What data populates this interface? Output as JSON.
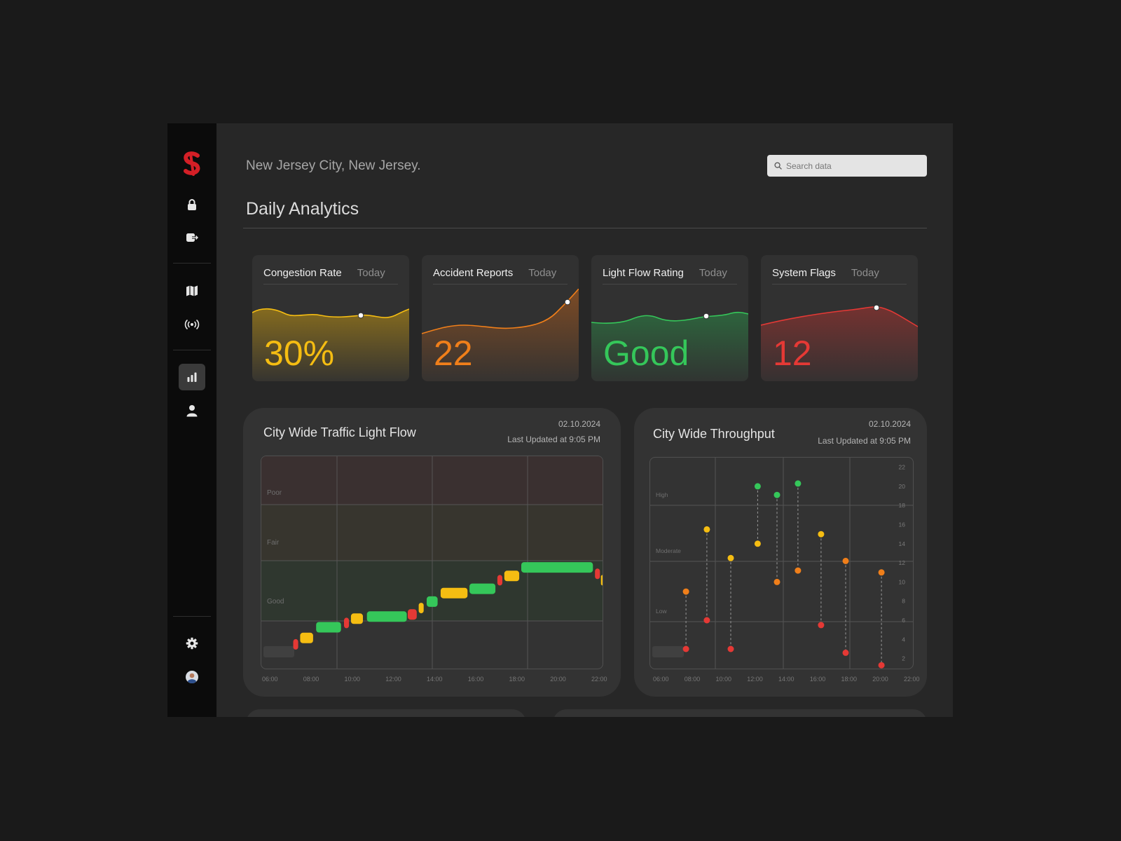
{
  "header": {
    "location": "New Jersey City, New Jersey.",
    "search_placeholder": "Search data",
    "page_title": "Daily Analytics"
  },
  "colors": {
    "yellow": "#f5bd12",
    "orange": "#f07f1a",
    "green": "#35c75a",
    "red": "#e53935",
    "brand": "#d41f26"
  },
  "sidebar": {
    "items": [
      {
        "icon": "lock-icon"
      },
      {
        "icon": "logout-icon"
      },
      {
        "icon": "map-icon"
      },
      {
        "icon": "broadcast-icon"
      },
      {
        "icon": "bar-chart-icon",
        "active": true
      },
      {
        "icon": "user-icon"
      },
      {
        "icon": "gear-icon"
      },
      {
        "icon": "avatar"
      }
    ]
  },
  "kpis": [
    {
      "name": "Congestion Rate",
      "period": "Today",
      "value": "30%",
      "color": "#f5bd12"
    },
    {
      "name": "Accident Reports",
      "period": "Today",
      "value": "22",
      "color": "#f07f1a"
    },
    {
      "name": "Light Flow Rating",
      "period": "Today",
      "value": "Good",
      "color": "#35c75a"
    },
    {
      "name": "System Flags",
      "period": "Today",
      "value": "12",
      "color": "#e53935"
    }
  ],
  "cards": {
    "light_flow": {
      "title": "City Wide Traffic Light Flow",
      "date": "02.10.2024",
      "updated": "Last Updated at 9:05 PM"
    },
    "throughput": {
      "title": "City Wide Throughput",
      "date": "02.10.2024",
      "updated": "Last Updated at 9:05 PM"
    }
  },
  "chart_data": [
    {
      "type": "bar",
      "title": "City Wide Traffic Light Flow",
      "x_ticks": [
        "06:00",
        "08:00",
        "10:00",
        "12:00",
        "14:00",
        "16:00",
        "18:00",
        "20:00",
        "22:00"
      ],
      "bands": [
        "Poor",
        "Fair",
        "Good"
      ],
      "xlim": [
        6,
        23.2
      ],
      "ylim": [
        0,
        100
      ],
      "segments": [
        {
          "start": 7.6,
          "end": 7.85,
          "level": 12,
          "rating": "Poor"
        },
        {
          "start": 7.95,
          "end": 8.6,
          "level": 15,
          "rating": "Fair"
        },
        {
          "start": 8.75,
          "end": 10.0,
          "level": 20,
          "rating": "Good"
        },
        {
          "start": 10.15,
          "end": 10.4,
          "level": 22,
          "rating": "Poor"
        },
        {
          "start": 10.5,
          "end": 11.1,
          "level": 24,
          "rating": "Fair"
        },
        {
          "start": 11.3,
          "end": 13.3,
          "level": 25,
          "rating": "Good"
        },
        {
          "start": 13.35,
          "end": 13.8,
          "level": 26,
          "rating": "Poor"
        },
        {
          "start": 13.9,
          "end": 14.15,
          "level": 29,
          "rating": "Fair"
        },
        {
          "start": 14.3,
          "end": 14.85,
          "level": 32,
          "rating": "Good"
        },
        {
          "start": 15.0,
          "end": 16.35,
          "level": 36,
          "rating": "Fair"
        },
        {
          "start": 16.45,
          "end": 17.75,
          "level": 38,
          "rating": "Good"
        },
        {
          "start": 17.85,
          "end": 18.1,
          "level": 42,
          "rating": "Poor"
        },
        {
          "start": 18.2,
          "end": 18.95,
          "level": 44,
          "rating": "Fair"
        },
        {
          "start": 19.05,
          "end": 22.65,
          "level": 48,
          "rating": "Good"
        },
        {
          "start": 22.75,
          "end": 23.0,
          "level": 45,
          "rating": "Poor"
        },
        {
          "start": 23.05,
          "end": 23.25,
          "level": 42,
          "rating": "Fair"
        },
        {
          "start": 23.3,
          "end": 23.5,
          "level": 39,
          "rating": "Good"
        }
      ]
    },
    {
      "type": "scatter",
      "title": "City Wide Throughput",
      "x_ticks": [
        "06:00",
        "08:00",
        "10:00",
        "12:00",
        "14:00",
        "16:00",
        "18:00",
        "20:00",
        "22:00"
      ],
      "y_ticks": [
        2,
        4,
        6,
        8,
        10,
        12,
        14,
        16,
        18,
        20,
        22
      ],
      "bands": [
        "High",
        "Moderate",
        "Low"
      ],
      "xlim": [
        5.7,
        23.4
      ],
      "ylim": [
        0.8,
        23
      ],
      "pairs": [
        {
          "x": 8.1,
          "high": 9.0,
          "high_color": "orange",
          "low": 3.0,
          "low_color": "red"
        },
        {
          "x": 9.5,
          "high": 15.5,
          "high_color": "yellow",
          "low": 6.0,
          "low_color": "red"
        },
        {
          "x": 11.1,
          "high": 12.5,
          "high_color": "yellow",
          "low": 3.0,
          "low_color": "red"
        },
        {
          "x": 12.9,
          "high": 20.0,
          "high_color": "green",
          "low": 14.0,
          "low_color": "yellow"
        },
        {
          "x": 14.2,
          "high": 19.1,
          "high_color": "green",
          "low": 10.0,
          "low_color": "orange"
        },
        {
          "x": 15.6,
          "high": 20.3,
          "high_color": "green",
          "low": 11.2,
          "low_color": "orange"
        },
        {
          "x": 17.15,
          "high": 15.0,
          "high_color": "yellow",
          "low": 5.5,
          "low_color": "red"
        },
        {
          "x": 18.8,
          "high": 12.2,
          "high_color": "orange",
          "low": 2.6,
          "low_color": "red"
        },
        {
          "x": 21.2,
          "high": 11.0,
          "high_color": "orange",
          "low": 1.3,
          "low_color": "red"
        }
      ]
    }
  ]
}
